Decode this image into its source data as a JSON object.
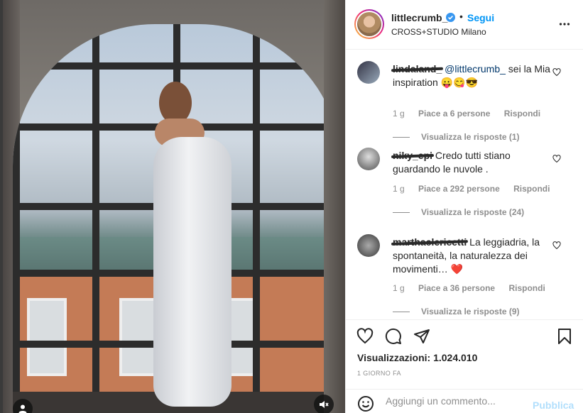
{
  "post": {
    "username": "littlecrumb_",
    "separator": "•",
    "follow_label": "Segui",
    "location": "CROSS+STUDIO Milano",
    "views_label": "Visualizzazioni: 1.024.010",
    "time_ago": "1 GIORNO FA"
  },
  "comments": [
    {
      "user": "lindaland_",
      "text_parts": {
        "mention": "@littlecrumb_",
        "body": " sei la Mia inspiration 😛😋😎"
      },
      "age": "1 g",
      "likes": "Piace a 6 persone",
      "reply": "Rispondi",
      "view_replies": "Visualizza le risposte (1)"
    },
    {
      "user": "niky_epi",
      "text": " Credo tutti stiano guardando le nuvole .",
      "age": "1 g",
      "likes": "Piace a 292 persone",
      "reply": "Rispondi",
      "view_replies": "Visualizza le risposte (24)"
    },
    {
      "user": "marthaclericetti",
      "text": " La leggiadria, la spontaneità, la naturalezza dei movimenti… ❤️",
      "age": "1 g",
      "likes": "Piace a 36 persone",
      "reply": "Rispondi",
      "view_replies": "Visualizza le risposte (9)"
    }
  ],
  "add_comment": {
    "placeholder": "Aggiungi un commento...",
    "publish_label": "Pubblica"
  },
  "icons": {
    "verified": "verified-badge-icon",
    "more": "more-options-icon",
    "like": "heart-icon",
    "comment": "comment-icon",
    "share": "paper-plane-icon",
    "save": "bookmark-icon",
    "emoji": "smiley-icon",
    "mute": "volume-muted-icon",
    "tagged_user": "user-icon"
  },
  "colors": {
    "accent": "#0095f6",
    "publish_disabled": "#b2dffc",
    "heart_red": "#ed4956"
  }
}
